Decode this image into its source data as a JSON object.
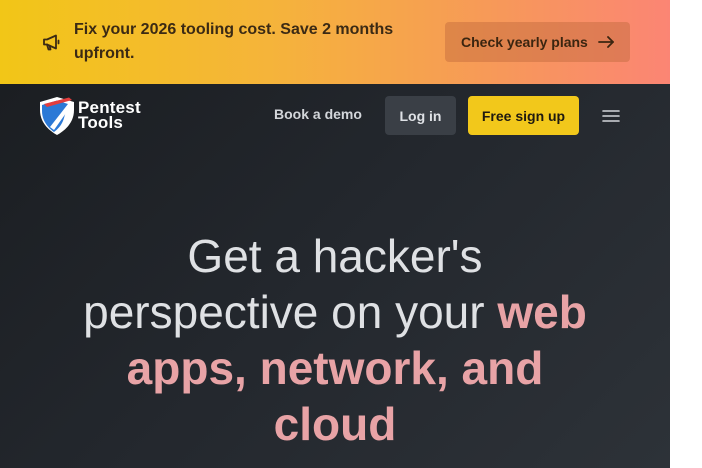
{
  "banner": {
    "icon": "megaphone-icon",
    "text": "Fix your 2026 tooling cost. Save 2 months upfront.",
    "cta_label": "Check yearly plans",
    "cta_icon": "arrow-right-icon",
    "colors": {
      "gradient_start": "#f2c617",
      "gradient_end": "#fb8574"
    }
  },
  "header": {
    "logo": {
      "line1": "Pentest",
      "line2": "Tools",
      "icon": "shield-logo-icon"
    },
    "nav": {
      "book_demo": "Book a demo",
      "login": "Log in",
      "signup": "Free sign up",
      "menu_icon": "hamburger-menu-icon"
    },
    "colors": {
      "signup_bg": "#f2c81b",
      "background": "#1b1e22"
    }
  },
  "hero": {
    "line1": "Get a hacker's",
    "line2_plain": "perspective on your ",
    "line2_highlight": "web",
    "line3_highlight": "apps, network, and",
    "line4_highlight": "cloud",
    "colors": {
      "text": "#dfe1e4",
      "highlight": "#e8a3a6"
    }
  }
}
